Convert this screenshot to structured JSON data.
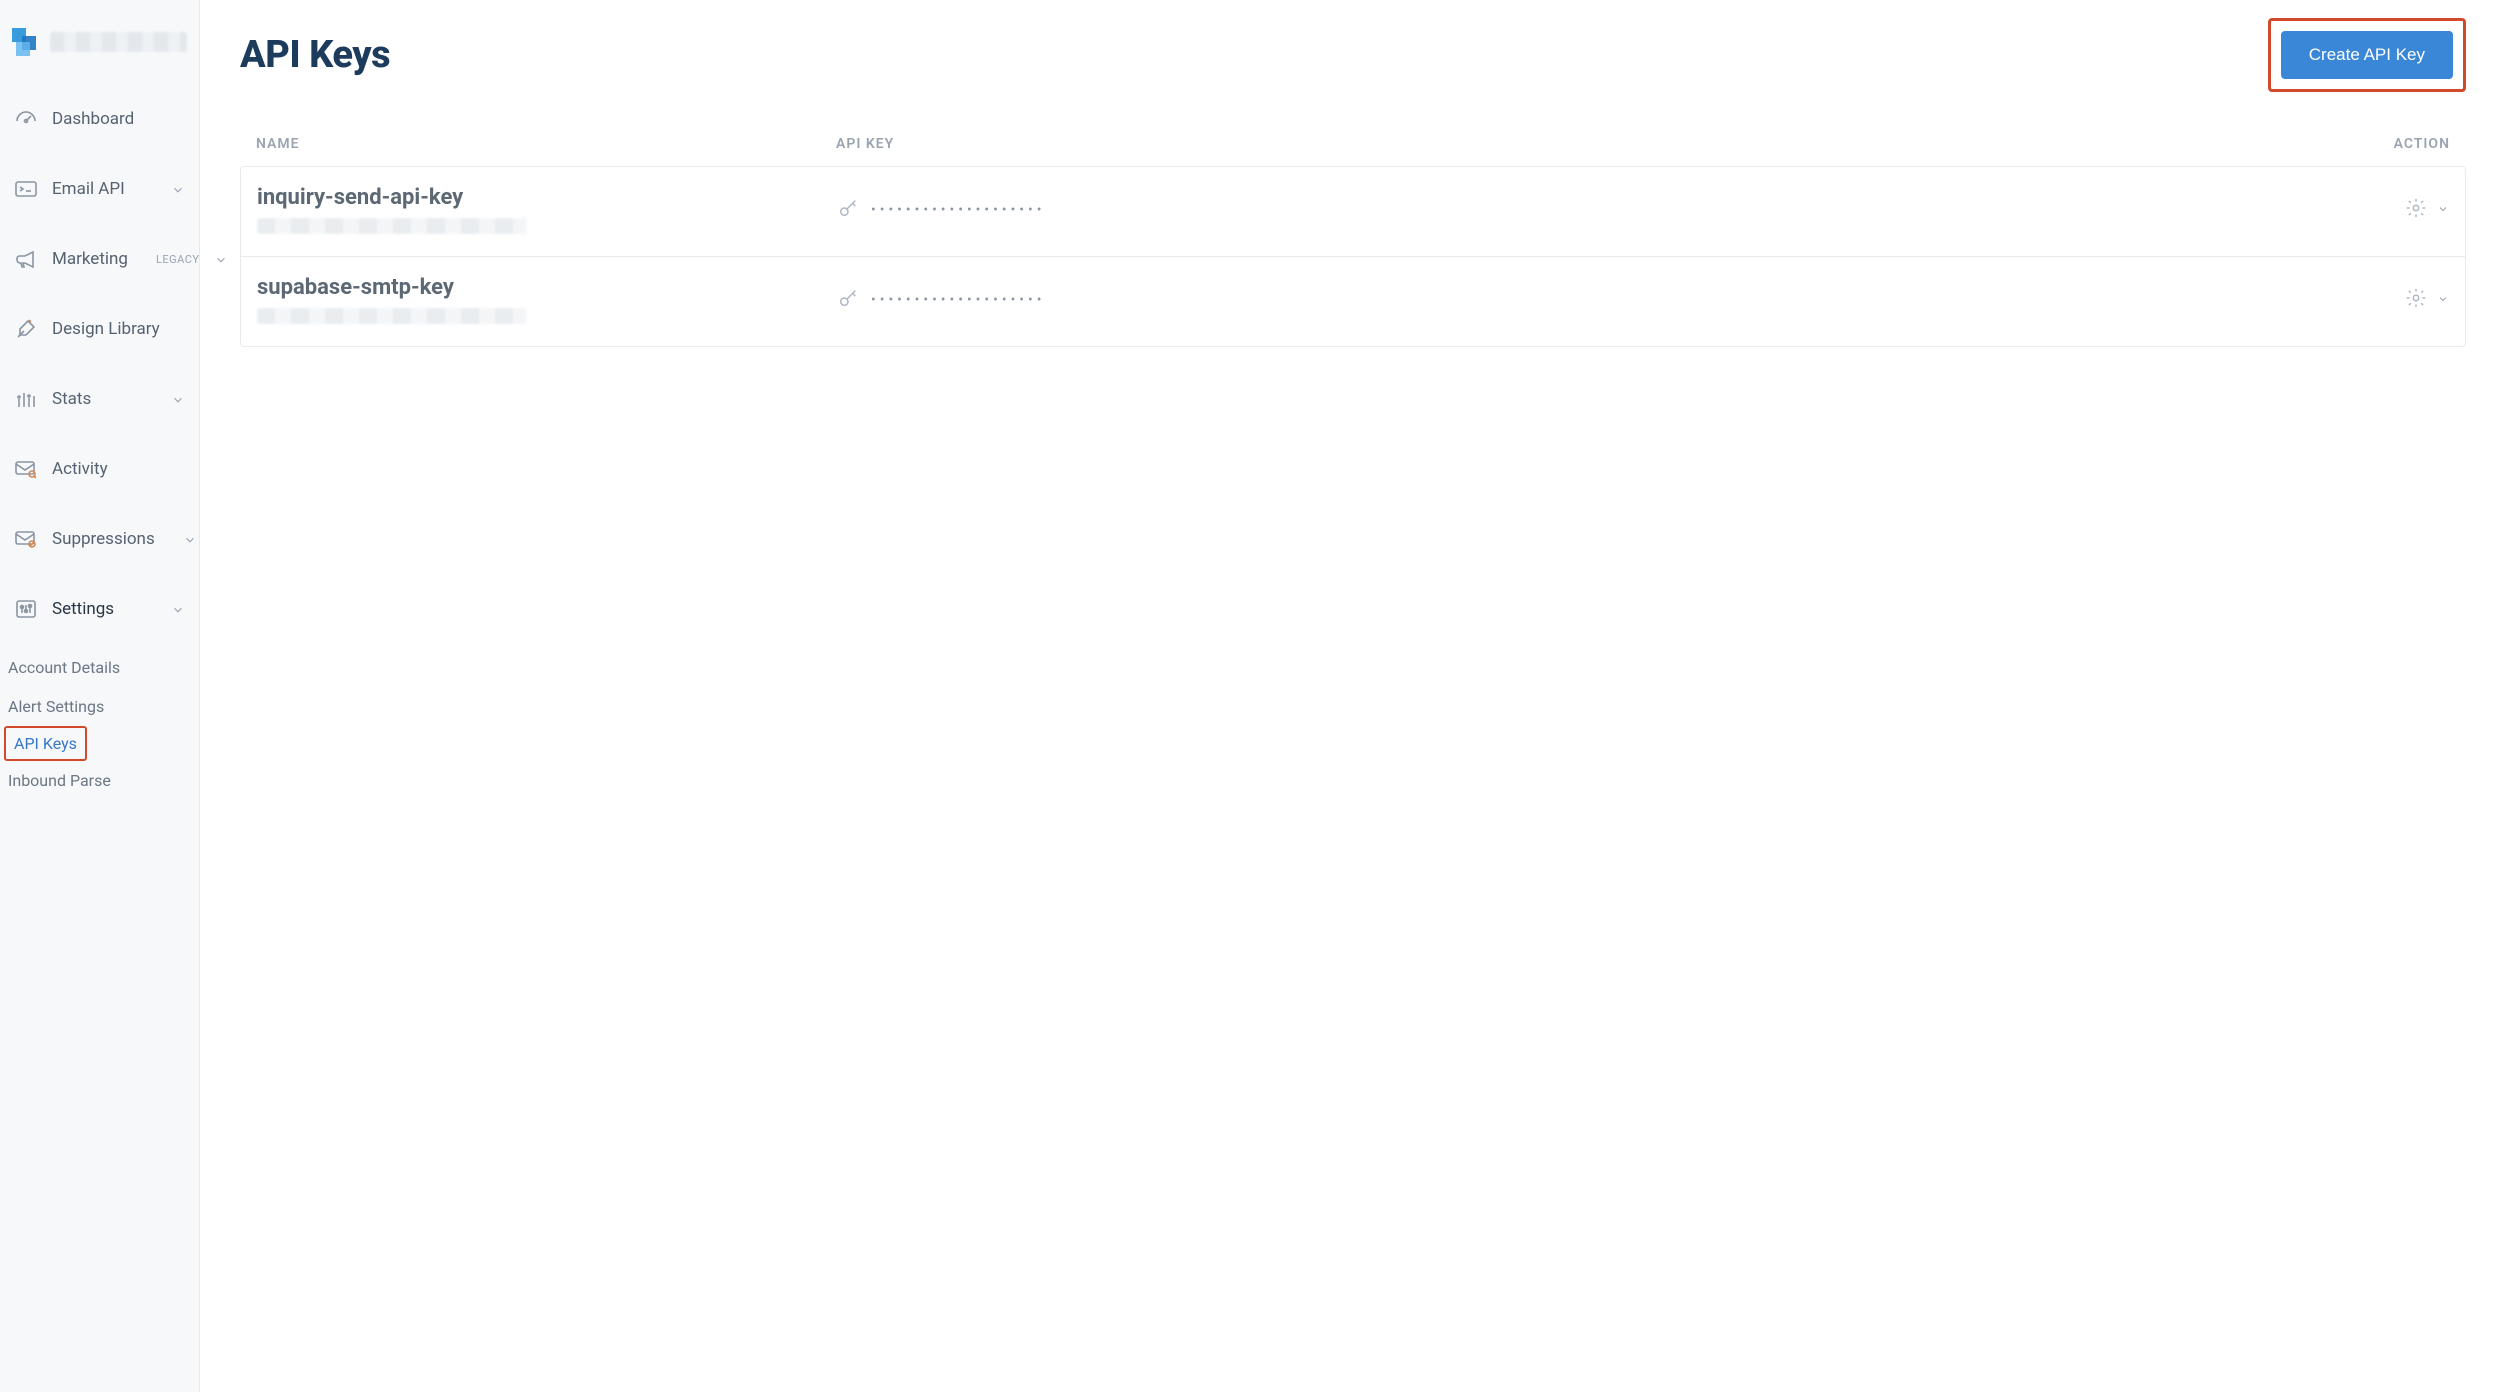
{
  "page": {
    "title": "API Keys",
    "create_button_label": "Create API Key"
  },
  "sidebar": {
    "items": [
      {
        "label": "Dashboard",
        "expandable": false
      },
      {
        "label": "Email API",
        "expandable": true
      },
      {
        "label": "Marketing",
        "expandable": true,
        "badge": "LEGACY"
      },
      {
        "label": "Design Library",
        "expandable": false
      },
      {
        "label": "Stats",
        "expandable": true
      },
      {
        "label": "Activity",
        "expandable": false
      },
      {
        "label": "Suppressions",
        "expandable": true
      },
      {
        "label": "Settings",
        "expandable": true,
        "active": true
      }
    ],
    "settings_subitems": [
      {
        "label": "Account Details"
      },
      {
        "label": "Alert Settings"
      },
      {
        "label": "API Keys",
        "active": true
      },
      {
        "label": "Inbound Parse"
      }
    ]
  },
  "table": {
    "columns": {
      "name": "NAME",
      "key": "API KEY",
      "action": "ACTION"
    },
    "rows": [
      {
        "name": "inquiry-send-api-key",
        "masked_key": "••••••••••••••••••••"
      },
      {
        "name": "supabase-smtp-key",
        "masked_key": "••••••••••••••••••••"
      }
    ]
  }
}
